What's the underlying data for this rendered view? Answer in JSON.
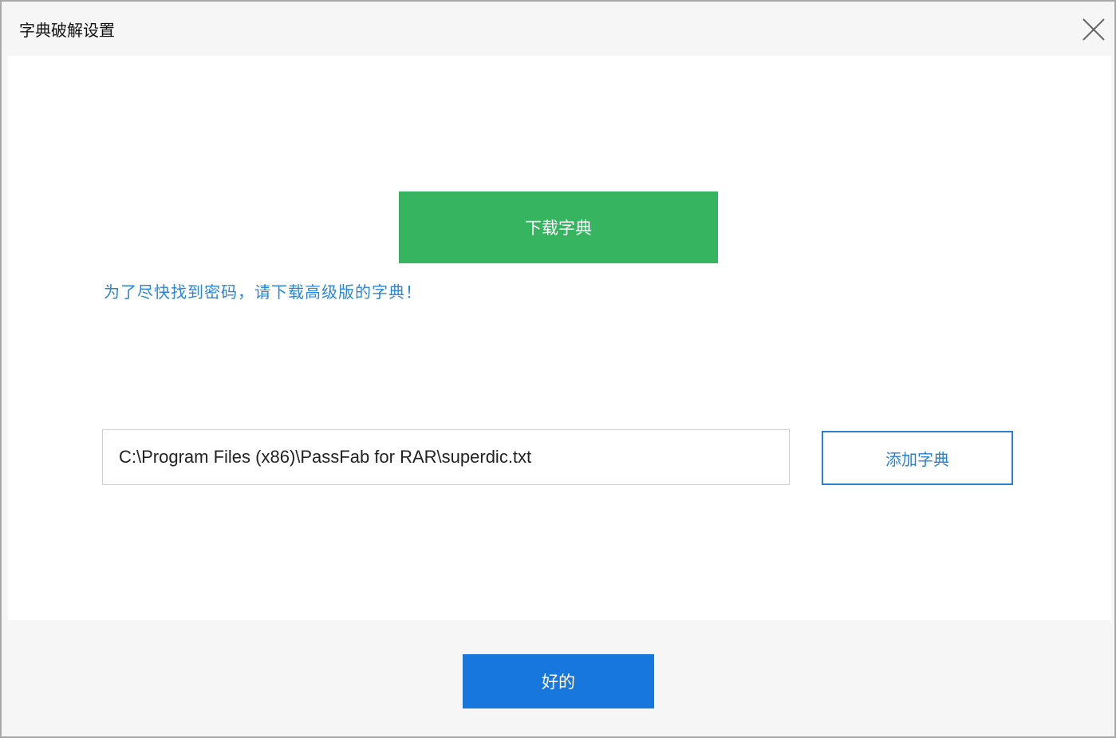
{
  "dialog": {
    "title": "字典破解设置"
  },
  "download_button": "下载字典",
  "hint": "为了尽快找到密码，请下载高级版的字典！",
  "dictionary_path": "C:\\Program Files (x86)\\PassFab for RAR\\superdic.txt",
  "add_dictionary_button": "添加字典",
  "ok_button": "好的",
  "colors": {
    "download": "#36b460",
    "primary": "#1777dd",
    "link": "#2a86d6"
  }
}
